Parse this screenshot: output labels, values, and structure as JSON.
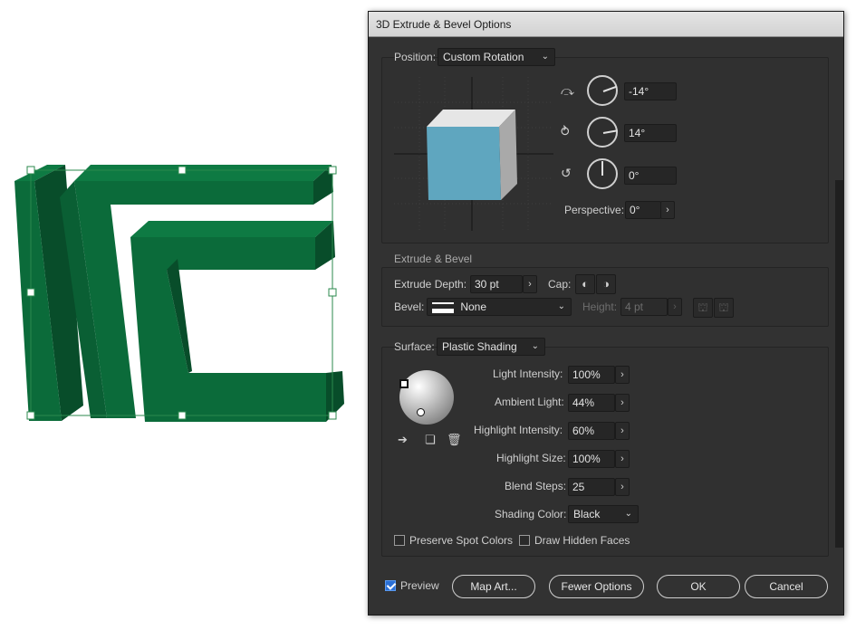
{
  "window": {
    "title": "3D Extrude & Bevel Options"
  },
  "position": {
    "label": "Position:",
    "value": "Custom Rotation",
    "rotation_x": "-14°",
    "rotation_y": "14°",
    "rotation_z": "0°",
    "perspective_label": "Perspective:",
    "perspective_value": "0°"
  },
  "extrude": {
    "section_title": "Extrude & Bevel",
    "depth_label": "Extrude Depth:",
    "depth_value": "30 pt",
    "cap_label": "Cap:",
    "bevel_label": "Bevel:",
    "bevel_value": "None",
    "height_label": "Height:",
    "height_value": "4 pt"
  },
  "surface": {
    "label": "Surface:",
    "value": "Plastic Shading",
    "light_intensity_label": "Light Intensity:",
    "light_intensity_value": "100%",
    "ambient_light_label": "Ambient Light:",
    "ambient_light_value": "44%",
    "highlight_intensity_label": "Highlight Intensity:",
    "highlight_intensity_value": "60%",
    "highlight_size_label": "Highlight Size:",
    "highlight_size_value": "100%",
    "blend_steps_label": "Blend Steps:",
    "blend_steps_value": "25",
    "shading_color_label": "Shading Color:",
    "shading_color_value": "Black"
  },
  "options": {
    "preserve_spot_colors": "Preserve Spot Colors",
    "draw_hidden_faces": "Draw Hidden Faces"
  },
  "buttons": {
    "preview": "Preview",
    "map_art": "Map Art...",
    "fewer_options": "Fewer Options",
    "ok": "OK",
    "cancel": "Cancel"
  },
  "colors": {
    "extrude_green": "#0b6b3a",
    "cube_front": "#5fa6bf",
    "accent_blue": "#2a6fd6"
  },
  "icons": {
    "rotate_x": "rotate-x-icon",
    "rotate_y": "rotate-y-icon",
    "rotate_z": "rotate-z-icon",
    "cap_on": "cap-on-icon",
    "cap_off": "cap-off-icon",
    "bevel_out": "bevel-out-icon",
    "bevel_in": "bevel-in-icon",
    "move_light_back": "move-light-back-icon",
    "new_light": "new-light-icon",
    "delete_light": "trash-icon"
  }
}
